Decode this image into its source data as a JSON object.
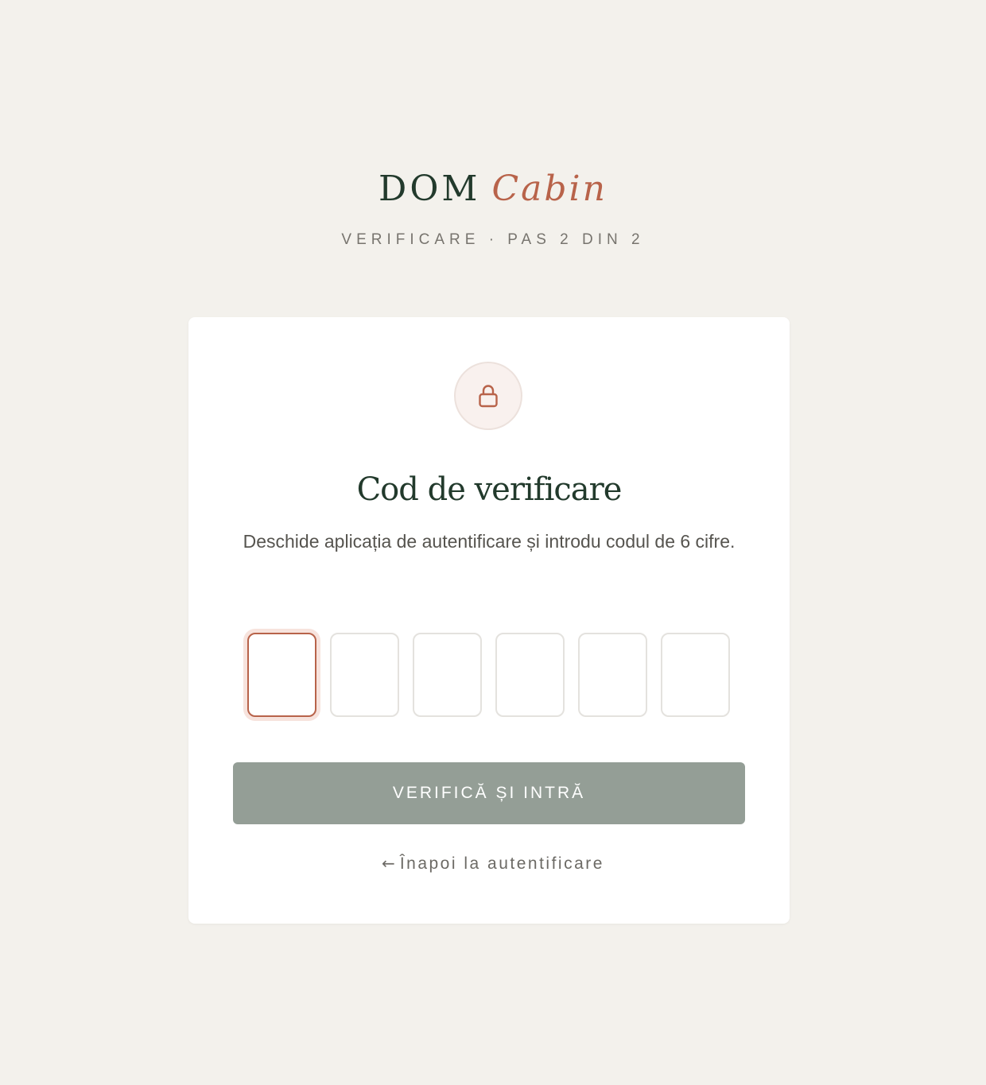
{
  "brand": {
    "name_part1": "DOM",
    "name_part2": "Cabin"
  },
  "step_label": "VERIFICARE · PAS 2 DIN 2",
  "card": {
    "icon": "lock-icon",
    "title": "Cod de verificare",
    "description": "Deschide aplicația de autentificare și introdu codul de 6 cifre.",
    "otp_digits": [
      "",
      "",
      "",
      "",
      "",
      ""
    ],
    "active_digit_index": 0,
    "verify_button_label": "VERIFICĂ ȘI INTRĂ",
    "back_arrow": "←",
    "back_link_label": "Înapoi la autentificare"
  },
  "colors": {
    "background": "#f3f1ec",
    "brand_green": "#223a2c",
    "accent_terracotta": "#b8634a",
    "button_disabled": "#949e96",
    "card": "#ffffff"
  }
}
